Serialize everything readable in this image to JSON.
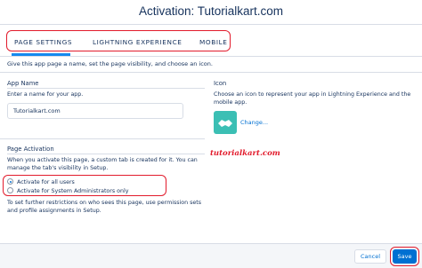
{
  "modal": {
    "title": "Activation: Tutorialkart.com"
  },
  "tabs": [
    {
      "label": "PAGE SETTINGS",
      "active": true
    },
    {
      "label": "LIGHTNING EXPERIENCE",
      "active": false
    },
    {
      "label": "MOBILE",
      "active": false
    }
  ],
  "intro_text": "Give this app page a name, set the page visibility, and choose an icon.",
  "app_name": {
    "title": "App Name",
    "prompt": "Enter a name for your app.",
    "value": "Tutorialkart.com"
  },
  "icon_section": {
    "title": "Icon",
    "description_line1": "Choose an icon to represent your app in Lightning Experience and the",
    "description_line2": "mobile app.",
    "icon_name": "handshake-icon",
    "change_link": "Change..."
  },
  "watermark": "tutorialkart.com",
  "page_activation": {
    "title": "Page Activation",
    "description_line1": "When you activate this page, a custom tab is created for it. You can",
    "description_line2": "manage the tab's visibility in Setup.",
    "options": [
      {
        "label": "Activate for all users",
        "checked": true
      },
      {
        "label": "Activate for System Administrators only",
        "checked": false
      }
    ],
    "note_line1": "To set further restrictions on who sees this page, use permission sets",
    "note_line2": "and profile assignments in Setup."
  },
  "footer": {
    "cancel_label": "Cancel",
    "save_label": "Save"
  },
  "colors": {
    "accent": "#0070d2",
    "highlight": "#e21b2c",
    "icon_bg": "#3bbfb4"
  }
}
